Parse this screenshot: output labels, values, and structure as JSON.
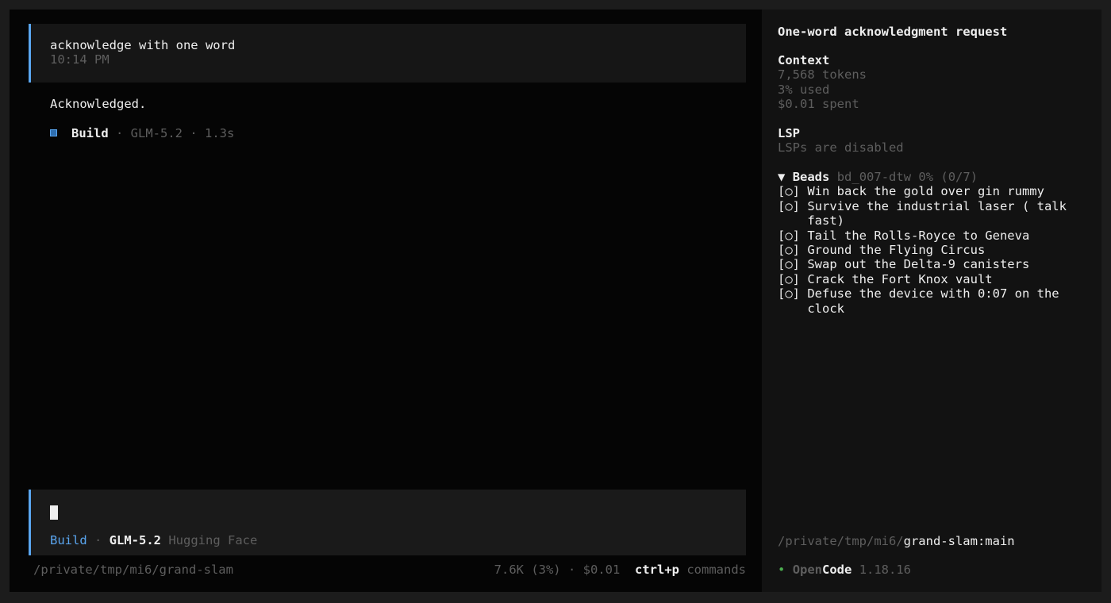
{
  "conversation": {
    "user_message": "acknowledge with one word",
    "user_time": "10:14 PM",
    "assistant_reply": "Acknowledged.",
    "agent": "Build",
    "model": "GLM-5.2",
    "duration": "1.3s"
  },
  "input": {
    "agent": "Build",
    "model": "GLM-5.2",
    "provider": "Hugging Face"
  },
  "status_bar": {
    "path": "/private/tmp/mi6/grand-slam",
    "usage": "7.6K (3%)",
    "cost": "$0.01",
    "shortcut": "ctrl+p",
    "shortcut_label": "commands"
  },
  "sidebar": {
    "title": "One-word acknowledgment request",
    "context": {
      "heading": "Context",
      "tokens": "7,568 tokens",
      "used": "3% used",
      "spent": "$0.01 spent"
    },
    "lsp": {
      "heading": "LSP",
      "status": "LSPs are disabled"
    },
    "beads": {
      "toggle": "▼",
      "heading": "Beads",
      "id": "bd_007-dtw",
      "percent": "0%",
      "count": "(0/7)",
      "tasks": [
        {
          "mark": "[○]",
          "label": "Win back the gold over gin rummy"
        },
        {
          "mark": "[○]",
          "label": "Survive the industrial laser ( talk fast)"
        },
        {
          "mark": "[○]",
          "label": "Tail the Rolls-Royce to Geneva"
        },
        {
          "mark": "[○]",
          "label": "Ground the Flying Circus"
        },
        {
          "mark": "[○]",
          "label": "Swap out the Delta-9 canisters"
        },
        {
          "mark": "[○]",
          "label": "Crack the Fort Knox vault"
        },
        {
          "mark": "[○]",
          "label": "Defuse the device with 0:07 on the clock"
        }
      ]
    },
    "path_prefix": "/private/tmp/mi6/",
    "path_branch": "grand-slam:main",
    "brand_open": "Open",
    "brand_code": "Code",
    "version": "1.18.16",
    "dot_color": "#4caf50"
  }
}
